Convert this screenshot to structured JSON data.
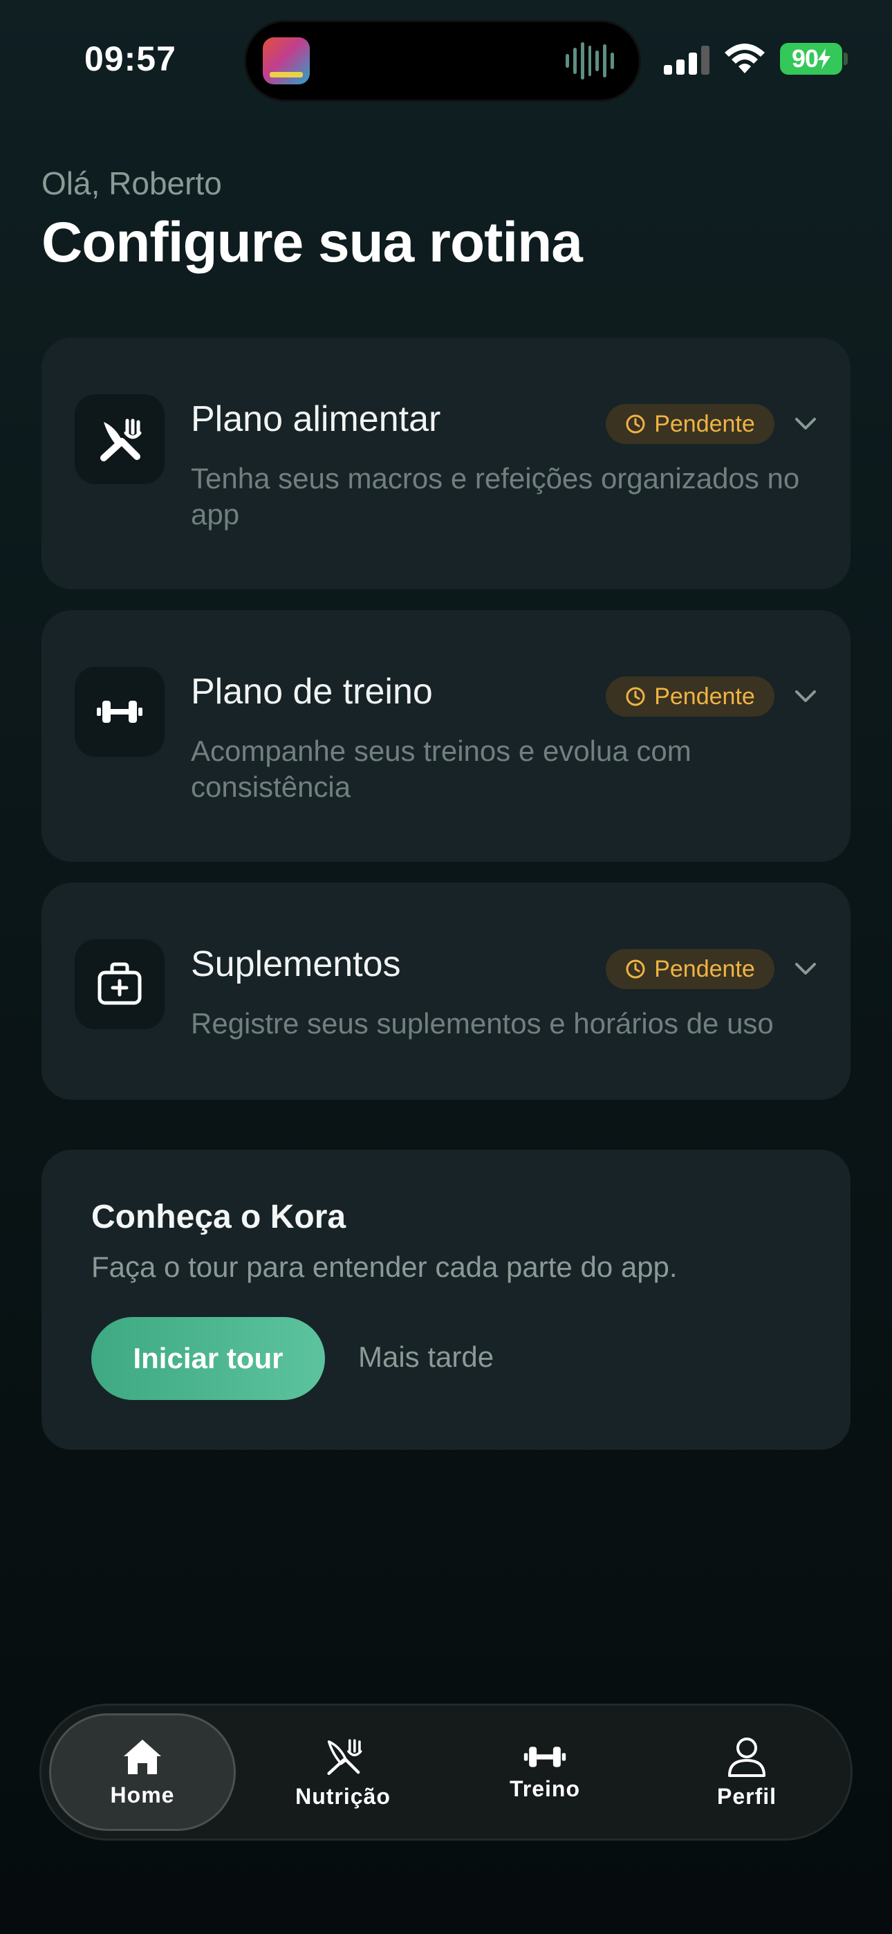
{
  "status_bar": {
    "time": "09:57",
    "battery": "90"
  },
  "header": {
    "greeting": "Olá, Roberto",
    "title": "Configure sua rotina"
  },
  "cards": [
    {
      "icon": "utensils-icon",
      "title": "Plano alimentar",
      "status": "Pendente",
      "description": "Tenha seus macros e refeições organizados no app"
    },
    {
      "icon": "dumbbell-icon",
      "title": "Plano de treino",
      "status": "Pendente",
      "description": "Acompanhe seus treinos e evolua com consistência"
    },
    {
      "icon": "medical-kit-icon",
      "title": "Suplementos",
      "status": "Pendente",
      "description": "Registre seus suplementos e horários de uso"
    }
  ],
  "tour": {
    "title": "Conheça o Kora",
    "description": "Faça o tour para entender cada parte do app.",
    "start_label": "Iniciar tour",
    "later_label": "Mais tarde"
  },
  "tabbar": {
    "items": [
      {
        "label": "Home",
        "icon": "home-icon",
        "active": true
      },
      {
        "label": "Nutrição",
        "icon": "utensils-icon",
        "active": false
      },
      {
        "label": "Treino",
        "icon": "dumbbell-icon",
        "active": false
      },
      {
        "label": "Perfil",
        "icon": "user-icon",
        "active": false
      }
    ]
  },
  "colors": {
    "accent": "#4cb892",
    "pending": "#f0b443",
    "background": "#0b1618",
    "card": "#172326"
  }
}
